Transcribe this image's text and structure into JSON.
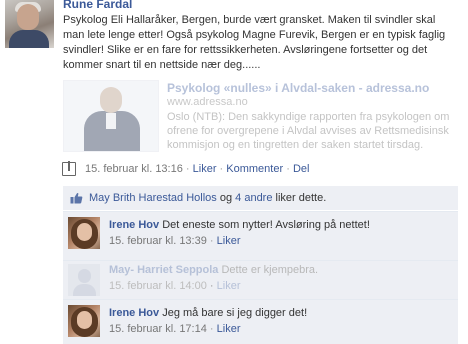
{
  "post": {
    "author": "Rune Fardal",
    "text": "Psykolog Eli Hallaråker, Bergen, burde vært gransket. Maken til svindler skal man lete lenge etter! Også psykolog Magne Furevik, Bergen er en typisk faglig svindler! Slike er en fare for rettssikkerheten. Avsløringene fortsetter og det kommer snart til en nettside nær deg......",
    "share": {
      "title": "Psykolog «nulles» i Alvdal-saken - adressa.no",
      "url": "www.adressa.no",
      "description": "Oslo (NTB): Den sakkyndige rapporten fra psykologen om ofrene for overgrepene i Alvdal avvises av Rettsmedisinsk kommisjon og en tingretten der saken startet tirsdag."
    },
    "meta": {
      "timestamp": "15. februar kl. 13:16",
      "like": "Liker",
      "comment": "Kommenter",
      "share": "Del",
      "separator": "·"
    },
    "likes": {
      "name": "May Brith Harestad Hollos",
      "and": "og",
      "others": "4 andre",
      "suffix": "liker dette."
    }
  },
  "comments": [
    {
      "author": "Irene Hov",
      "text": "Det eneste som nytter! Avsløring på nettet!",
      "timestamp": "15. februar kl. 13:39",
      "like": "Liker",
      "separator": "·"
    },
    {
      "author": "May- Harriet Seppola",
      "text": "Dette er kjempebra.",
      "timestamp": "15. februar kl. 14:00",
      "like": "Liker",
      "separator": "·"
    },
    {
      "author": "Irene Hov",
      "text": "Jeg må bare si jeg digger det!",
      "timestamp": "15. februar kl. 17:14",
      "like": "Liker",
      "separator": "·"
    }
  ],
  "colors": {
    "link": "#3b5998",
    "comment_bg": "#edeff4",
    "meta_text": "#777777"
  },
  "icons": [
    "profile-photo",
    "share-thumbnail",
    "comment-bubble-icon",
    "thumbs-up-icon"
  ]
}
